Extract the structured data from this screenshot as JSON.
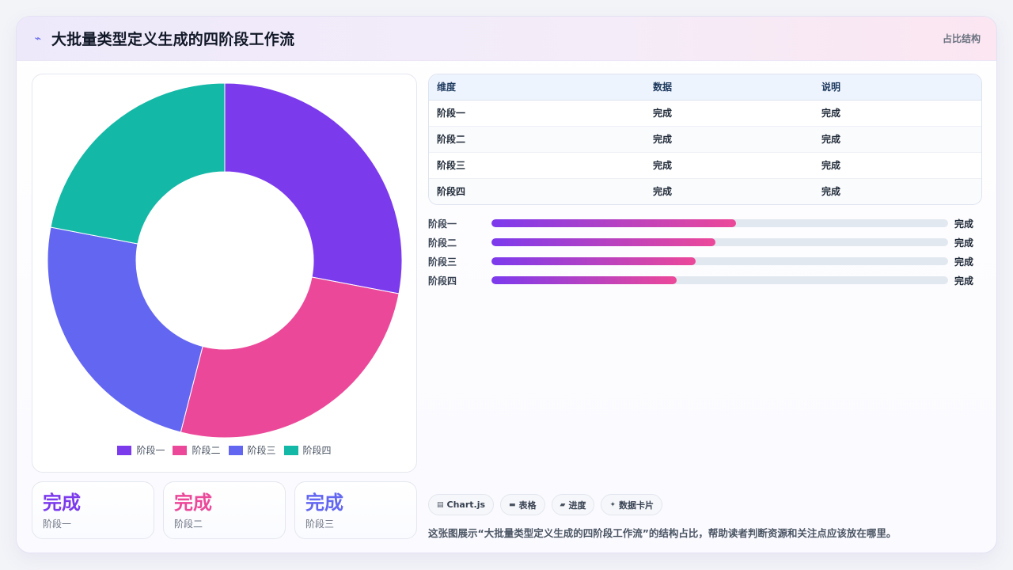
{
  "header": {
    "title": "大批量类型定义生成的四阶段工作流",
    "tag": "占比结构",
    "icon": "bolt-icon"
  },
  "colors": {
    "stage1": "#7c3aed",
    "stage2": "#ec4899",
    "stage3": "#6366f1",
    "stage4": "#14b8a6"
  },
  "chart_data": {
    "type": "pie",
    "variant": "doughnut",
    "categories": [
      "阶段一",
      "阶段二",
      "阶段三",
      "阶段四"
    ],
    "values": [
      28,
      26,
      24,
      22
    ],
    "colors": [
      "#7c3aed",
      "#ec4899",
      "#6366f1",
      "#14b8a6"
    ],
    "title": "",
    "legend": "bottom"
  },
  "stats": [
    {
      "value": "完成",
      "label": "阶段一",
      "color": "#7c3aed"
    },
    {
      "value": "完成",
      "label": "阶段二",
      "color": "#ec4899"
    },
    {
      "value": "完成",
      "label": "阶段三",
      "color": "#6366f1"
    }
  ],
  "table": {
    "headers": [
      "维度",
      "数据",
      "说明"
    ],
    "rows": [
      [
        "阶段一",
        "完成",
        "完成"
      ],
      [
        "阶段二",
        "完成",
        "完成"
      ],
      [
        "阶段三",
        "完成",
        "完成"
      ],
      [
        "阶段四",
        "完成",
        "完成"
      ]
    ]
  },
  "progress": [
    {
      "label": "阶段一",
      "fraction": 0.535,
      "value": "完成"
    },
    {
      "label": "阶段二",
      "fraction": 0.491,
      "value": "完成"
    },
    {
      "label": "阶段三",
      "fraction": 0.448,
      "value": "完成"
    },
    {
      "label": "阶段四",
      "fraction": 0.405,
      "value": "完成"
    }
  ],
  "chips": [
    {
      "icon": "chart-icon",
      "label": "Chart.js"
    },
    {
      "icon": "table-icon",
      "label": "表格"
    },
    {
      "icon": "progress-icon",
      "label": "进度"
    },
    {
      "icon": "sparkle-icon",
      "label": "数据卡片"
    }
  ],
  "note": "这张图展示“大批量类型定义生成的四阶段工作流”的结构占比，帮助读者判断资源和关注点应该放在哪里。"
}
